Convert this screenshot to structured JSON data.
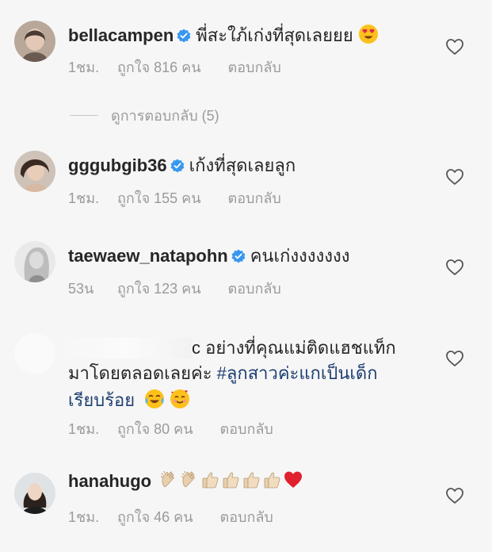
{
  "view_replies_label": "ดูการตอบกลับ (5)",
  "comments": [
    {
      "username": "bellacampen",
      "verified": true,
      "text": "พี่สะใภ้เก่งที่สุดเลยยย",
      "emoji": "heart-eyes",
      "time": "1ชม.",
      "likes": "ถูกใจ 816 คน",
      "reply": "ตอบกลับ"
    },
    {
      "username": "gggubgib36",
      "verified": true,
      "text": "เก้งที่สุดเลยลูก",
      "time": "1ชม.",
      "likes": "ถูกใจ 155 คน",
      "reply": "ตอบกลับ"
    },
    {
      "username": "taewaew_natapohn",
      "verified": true,
      "text": "คนเก่งงงงงงง",
      "time": "53น",
      "likes": "ถูกใจ 123 คน",
      "reply": "ตอบกลับ"
    },
    {
      "username": "",
      "verified": false,
      "text_line1": "c อย่างที่คุณแม่ติดแฮชแท็ก",
      "text_line2_plain": "มาโดยตลอดเลยค่ะ ",
      "hashtag_part1": "#ลูกสาวค่ะแกเป็นเด็ก",
      "hashtag_part2": "เรียบร้อย",
      "time": "1ชม.",
      "likes": "ถูกใจ 80 คน",
      "reply": "ตอบกลับ"
    },
    {
      "username": "hanahugo",
      "verified": false,
      "time": "1ชม.",
      "likes": "ถูกใจ 46 คน",
      "reply": "ตอบกลับ"
    }
  ],
  "colors": {
    "background": "#f6f6f6",
    "text": "#262626",
    "meta": "#9a9a9a",
    "verified": "#3897f0",
    "hashtag": "#1d3f72"
  }
}
